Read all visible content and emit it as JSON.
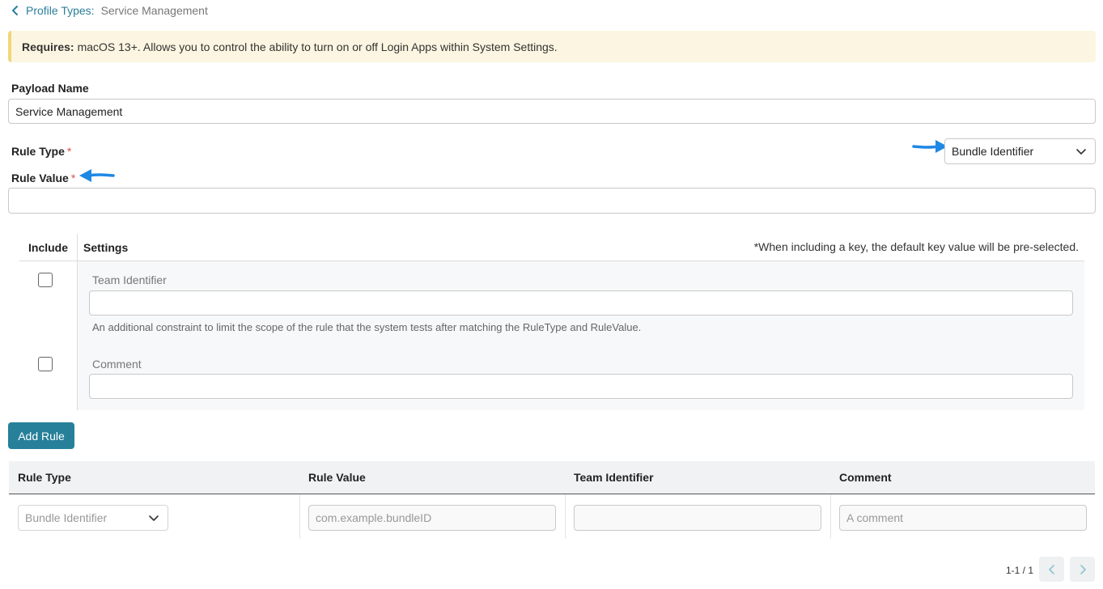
{
  "breadcrumb": {
    "link_label": "Profile Types:",
    "current": "Service Management"
  },
  "banner": {
    "bold": "Requires:",
    "text": "macOS 13+. Allows you to control the ability to turn on or off Login Apps within System Settings."
  },
  "payload": {
    "label": "Payload Name",
    "value": "Service Management"
  },
  "rule_type": {
    "label": "Rule Type",
    "required_mark": "*",
    "selected": "Bundle Identifier"
  },
  "rule_value": {
    "label": "Rule Value",
    "required_mark": "*",
    "value": ""
  },
  "settings": {
    "include_header": "Include",
    "settings_header": "Settings",
    "note": "*When including a key, the default key value will be pre-selected.",
    "items": [
      {
        "label": "Team Identifier",
        "value": "",
        "help": "An additional constraint to limit the scope of the rule that the system tests after matching the RuleType and RuleValue.",
        "checked": false
      },
      {
        "label": "Comment",
        "value": "",
        "help": "",
        "checked": false
      }
    ]
  },
  "add_rule_label": "Add Rule",
  "table": {
    "headers": [
      "Rule Type",
      "Rule Value",
      "Team Identifier",
      "Comment"
    ],
    "row": {
      "rule_type": "Bundle Identifier",
      "rule_value_placeholder": "com.example.bundleID",
      "team_identifier": "",
      "comment_placeholder": "A comment"
    }
  },
  "pagination": {
    "range": "1-1 / 1"
  },
  "colors": {
    "accent": "#26809a",
    "link": "#2a7f9a",
    "banner_bg": "#fcf5e1",
    "annotation_arrow": "#1e88e5"
  }
}
